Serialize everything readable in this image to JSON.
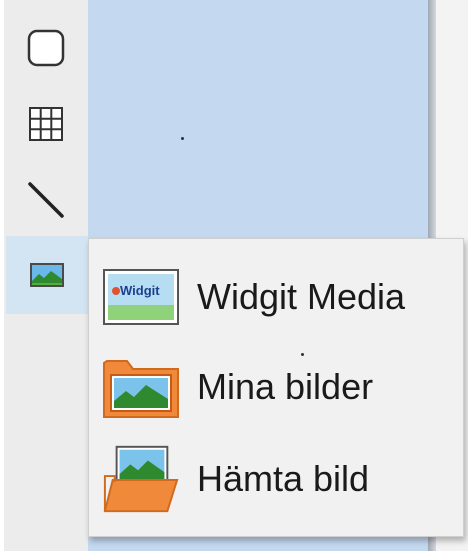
{
  "toolbar": {
    "tools": [
      {
        "icon": "rounded-rectangle-icon"
      },
      {
        "icon": "table-grid-icon"
      },
      {
        "icon": "line-icon"
      },
      {
        "icon": "image-icon",
        "selected": true
      }
    ]
  },
  "image_menu": {
    "items": [
      {
        "icon": "widgit-media-icon",
        "label": "Widgit Media",
        "icon_text": "Widgit"
      },
      {
        "icon": "folder-image-icon",
        "label": "Mina bilder"
      },
      {
        "icon": "open-image-icon",
        "label": "Hämta bild"
      }
    ]
  },
  "colors": {
    "canvas": "#c4d8ef",
    "toolbar": "#ececec",
    "selected_tool": "#d3e4f3",
    "menu": "#f1f1f1",
    "folder_orange": "#f08a3a"
  }
}
